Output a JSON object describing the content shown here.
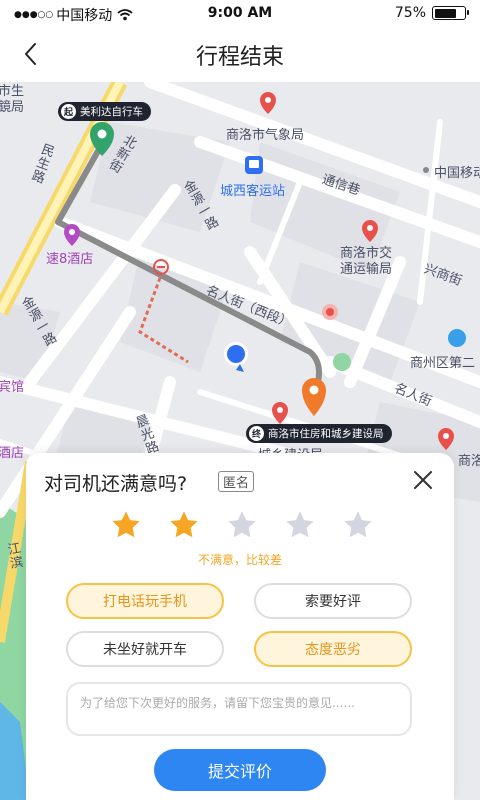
{
  "status_bar": {
    "signal_dots": "●●●○○",
    "carrier": "中国移动",
    "time": "9:00 AM",
    "battery": "75%",
    "battery_level": 0.75
  },
  "nav": {
    "title": "行程结束"
  },
  "map": {
    "labels": {
      "tl1": "市生",
      "tl2": "鏡局",
      "weather": "商洛市气象局",
      "bus_station": "城西客运站",
      "tongxin": "通信巷",
      "china_mobile": "中国移动",
      "hotel8": "速8酒店",
      "traffic": "商洛市交",
      "traffic2": "通运输局",
      "xingshang": "兴商街",
      "minren_west": "名人街（西段）",
      "shangzhou": "商州区第二",
      "minren": "名人街",
      "guesthouse": "宾馆",
      "hotel_left": "酒店",
      "shang_right": "商洛",
      "jianshe": "城乡建设局",
      "minsheng_road": "民生路",
      "jinyuan_road": "金源一路",
      "jinyuan_road2": "金源一路",
      "chenguang_road": "晨光路",
      "jiangbin_road": "江滨",
      "beixin": "北新街"
    },
    "start_tag": {
      "badge": "起",
      "text": "美利达自行车"
    },
    "end_tag": {
      "badge": "终",
      "text": "商洛市住房和城乡建设局"
    }
  },
  "sheet": {
    "title": "对司机还满意吗?",
    "anon": "匿名",
    "rating": 2,
    "rating_max": 5,
    "rating_text": "不满意，比较差",
    "tags": [
      {
        "label": "打电话玩手机",
        "active": true
      },
      {
        "label": "索要好评",
        "active": false
      },
      {
        "label": "未坐好就开车",
        "active": false
      },
      {
        "label": "态度恶劣",
        "active": true
      }
    ],
    "comment_placeholder": "为了给您下次更好的服务，请留下您宝贵的意见......",
    "submit": "提交评价"
  },
  "colors": {
    "star_on": "#f6a623",
    "star_off": "#d3d6e0",
    "tag_active_border": "#f6c344",
    "tag_active_bg": "#fff4dc",
    "primary": "#2e86f2",
    "route": "#8a8a8a"
  }
}
